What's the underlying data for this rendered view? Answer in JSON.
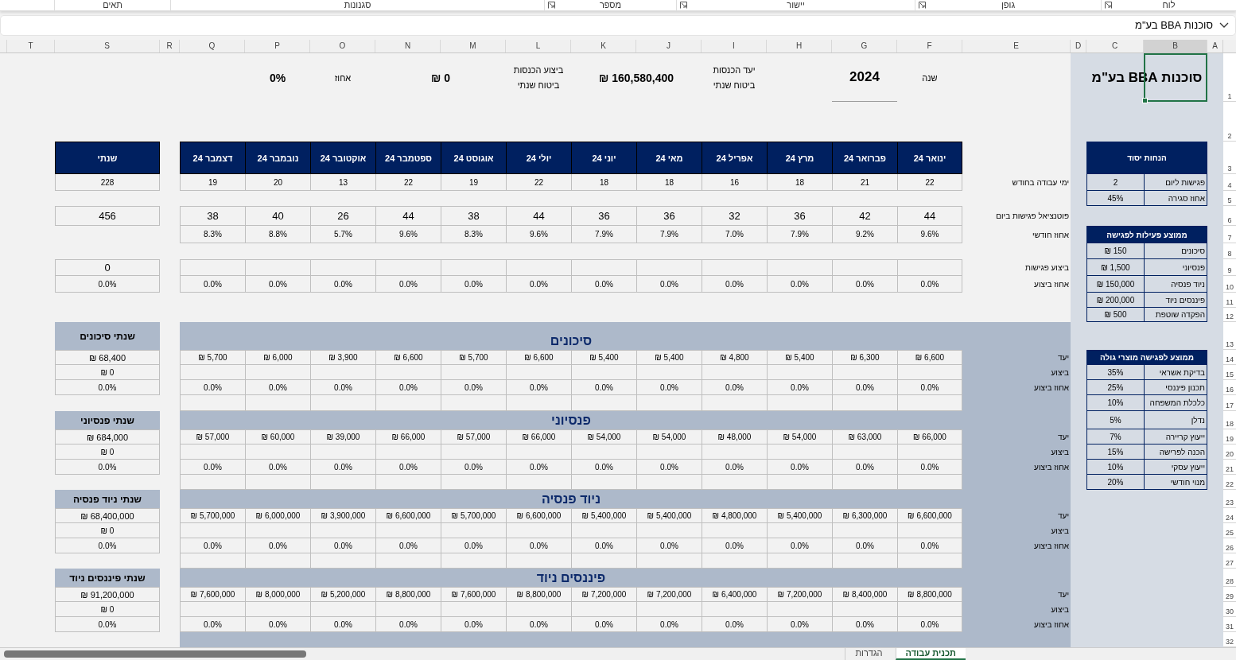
{
  "ribbon": {
    "groups": [
      {
        "label": "לוח",
        "launcher": true
      },
      {
        "label": "גופן",
        "launcher": true
      },
      {
        "label": "יישור",
        "launcher": true
      },
      {
        "label": "מספר",
        "launcher": true
      },
      {
        "label": "סגנונות",
        "launcher": false
      },
      {
        "label": "תאים",
        "launcher": false
      }
    ]
  },
  "name_box": {
    "value": "סוכנות BBA בע\"מ"
  },
  "column_headers": [
    "A",
    "B",
    "C",
    "D",
    "E",
    "F",
    "G",
    "H",
    "I",
    "J",
    "K",
    "L",
    "M",
    "N",
    "O",
    "P",
    "Q",
    "R",
    "S",
    "T"
  ],
  "row_numbers": [
    "1",
    "2",
    "3",
    "4",
    "5",
    "6",
    "7",
    "8",
    "9",
    "10",
    "11",
    "12",
    "13",
    "14",
    "15",
    "16",
    "17",
    "18",
    "19",
    "20",
    "21",
    "22",
    "23",
    "24",
    "25",
    "26",
    "27",
    "28",
    "29",
    "30",
    "31",
    "32"
  ],
  "sheet": {
    "title": {
      "text": "סוכנות BBA בע\"מ",
      "selected": true
    },
    "summary": {
      "year_label": "שנה",
      "year": "2024",
      "target_label": [
        "יעד הכנסות",
        "ביטוח שנתי"
      ],
      "target_value": "₪ 160,580,400",
      "performance_label": [
        "ביצוע הכנסות",
        "ביטוח שנתי"
      ],
      "performance_value": "₪ 0",
      "percent_label": "אחוז",
      "percent_value": "0%"
    },
    "row_labels": [
      "ימי עבודה בחודש",
      "פוטנציאל פגישות ביום",
      "אחוז חודשי",
      "ביצוע פגישות",
      "אחוז ביצוע"
    ],
    "months": [
      {
        "name": "ינואר 24",
        "work_days": "22",
        "potential": "44",
        "monthly_percent": "9.6%",
        "performance_percent": "0.0%"
      },
      {
        "name": "פברואר 24",
        "work_days": "21",
        "potential": "42",
        "monthly_percent": "9.2%",
        "performance_percent": "0.0%"
      },
      {
        "name": "מרץ 24",
        "work_days": "18",
        "potential": "36",
        "monthly_percent": "7.9%",
        "performance_percent": "0.0%"
      },
      {
        "name": "אפריל 24",
        "work_days": "16",
        "potential": "32",
        "monthly_percent": "7.0%",
        "performance_percent": "0.0%"
      },
      {
        "name": "מאי 24",
        "work_days": "18",
        "potential": "36",
        "monthly_percent": "7.9%",
        "performance_percent": "0.0%"
      },
      {
        "name": "יוני 24",
        "work_days": "18",
        "potential": "36",
        "monthly_percent": "7.9%",
        "performance_percent": "0.0%"
      },
      {
        "name": "יולי 24",
        "work_days": "22",
        "potential": "44",
        "monthly_percent": "9.6%",
        "performance_percent": "0.0%"
      },
      {
        "name": "אוגוסט 24",
        "work_days": "19",
        "potential": "38",
        "monthly_percent": "8.3%",
        "performance_percent": "0.0%"
      },
      {
        "name": "ספטמבר 24",
        "work_days": "22",
        "potential": "44",
        "monthly_percent": "9.6%",
        "performance_percent": "0.0%"
      },
      {
        "name": "אוקטובר 24",
        "work_days": "13",
        "potential": "26",
        "monthly_percent": "5.7%",
        "performance_percent": "0.0%"
      },
      {
        "name": "נובמבר 24",
        "work_days": "20",
        "potential": "40",
        "monthly_percent": "8.8%",
        "performance_percent": "0.0%"
      },
      {
        "name": "דצמבר 24",
        "work_days": "19",
        "potential": "38",
        "monthly_percent": "8.3%",
        "performance_percent": "0.0%"
      }
    ],
    "annual": {
      "header": "שנתי",
      "work_days": "228",
      "potential": "456",
      "meetings_done": "0",
      "performance_percent": "0.0%"
    },
    "sections": [
      {
        "title": "סיכונים",
        "annual_title": "שנתי סיכונים",
        "row_labels": [
          "יעד",
          "ביצוע",
          "אחוז ביצוע"
        ],
        "targets": [
          "₪ 6,600",
          "₪ 6,300",
          "₪ 5,400",
          "₪ 4,800",
          "₪ 5,400",
          "₪ 5,400",
          "₪ 6,600",
          "₪ 5,700",
          "₪ 6,600",
          "₪ 3,900",
          "₪ 6,000",
          "₪ 5,700"
        ],
        "percents": [
          "0.0%",
          "0.0%",
          "0.0%",
          "0.0%",
          "0.0%",
          "0.0%",
          "0.0%",
          "0.0%",
          "0.0%",
          "0.0%",
          "0.0%",
          "0.0%"
        ],
        "annual_target": "₪ 68,400",
        "annual_performance": "₪ 0",
        "annual_percent": "0.0%"
      },
      {
        "title": "פנסיוני",
        "annual_title": "שנתי פנסיוני",
        "row_labels": [
          "יעד",
          "ביצוע",
          "אחוז ביצוע"
        ],
        "targets": [
          "₪ 66,000",
          "₪ 63,000",
          "₪ 54,000",
          "₪ 48,000",
          "₪ 54,000",
          "₪ 54,000",
          "₪ 66,000",
          "₪ 57,000",
          "₪ 66,000",
          "₪ 39,000",
          "₪ 60,000",
          "₪ 57,000"
        ],
        "percents": [
          "0.0%",
          "0.0%",
          "0.0%",
          "0.0%",
          "0.0%",
          "0.0%",
          "0.0%",
          "0.0%",
          "0.0%",
          "0.0%",
          "0.0%",
          "0.0%"
        ],
        "annual_target": "₪ 684,000",
        "annual_performance": "₪ 0",
        "annual_percent": "0.0%"
      },
      {
        "title": "ניוד פנסיה",
        "annual_title": "שנתי ניוד פנסיה",
        "row_labels": [
          "יעד",
          "ביצוע",
          "אחוז ביצוע"
        ],
        "targets": [
          "₪ 6,600,000",
          "₪ 6,300,000",
          "₪ 5,400,000",
          "₪ 4,800,000",
          "₪ 5,400,000",
          "₪ 5,400,000",
          "₪ 6,600,000",
          "₪ 5,700,000",
          "₪ 6,600,000",
          "₪ 3,900,000",
          "₪ 6,000,000",
          "₪ 5,700,000"
        ],
        "percents": [
          "0.0%",
          "0.0%",
          "0.0%",
          "0.0%",
          "0.0%",
          "0.0%",
          "0.0%",
          "0.0%",
          "0.0%",
          "0.0%",
          "0.0%",
          "0.0%"
        ],
        "annual_target": "₪ 68,400,000",
        "annual_performance": "₪ 0",
        "annual_percent": "0.0%"
      },
      {
        "title": "פיננסים ניוד",
        "annual_title": "שנתי פיננסים ניוד",
        "row_labels": [
          "יעד",
          "ביצוע",
          "אחוז ביצוע"
        ],
        "targets": [
          "₪ 8,800,000",
          "₪ 8,400,000",
          "₪ 7,200,000",
          "₪ 6,400,000",
          "₪ 7,200,000",
          "₪ 7,200,000",
          "₪ 8,800,000",
          "₪ 7,600,000",
          "₪ 8,800,000",
          "₪ 5,200,000",
          "₪ 8,000,000",
          "₪ 7,600,000"
        ],
        "percents": [
          "0.0%",
          "0.0%",
          "0.0%",
          "0.0%",
          "0.0%",
          "0.0%",
          "0.0%",
          "0.0%",
          "0.0%",
          "0.0%",
          "0.0%",
          "0.0%"
        ],
        "annual_target": "₪ 91,200,000",
        "annual_performance": "₪ 0",
        "annual_percent": "0.0%"
      }
    ],
    "side_tables": [
      {
        "title": "הנחות יסוד",
        "rows": [
          {
            "label": "פגישות ליום",
            "value": "2"
          },
          {
            "label": "אחוז סגירה",
            "value": "45%"
          }
        ]
      },
      {
        "title": "ממוצע פעילות לפגישה",
        "rows": [
          {
            "label": "סיכונים",
            "value": "₪ 150"
          },
          {
            "label": "פנסיוני",
            "value": "₪ 1,500"
          },
          {
            "label": "ניוד פנסיה",
            "value": "₪ 150,000"
          },
          {
            "label": "פיננסים ניוד",
            "value": "₪ 200,000"
          },
          {
            "label": "הפקדה שוטפת",
            "value": "₪ 500"
          }
        ]
      },
      {
        "title": "ממוצע לפגישה מוצרי גולה",
        "rows": [
          {
            "label": "בדיקת אשראי",
            "value": "35%"
          },
          {
            "label": "תכנון פיננסי",
            "value": "25%"
          },
          {
            "label": "כלכלת המשפחה",
            "value": "10%"
          },
          {
            "label": "נדלן",
            "value": "5%"
          },
          {
            "label": "ייעוץ קריירה",
            "value": "7%"
          },
          {
            "label": "הכנה לפרישה",
            "value": "15%"
          },
          {
            "label": "ייעוץ עסקי",
            "value": "10%"
          },
          {
            "label": "מנוי חודשי",
            "value": "20%"
          }
        ]
      }
    ]
  },
  "sheet_tabs": [
    {
      "label": "תכנית עבודה",
      "selected": true
    },
    {
      "label": "הגדרות",
      "selected": false
    }
  ]
}
